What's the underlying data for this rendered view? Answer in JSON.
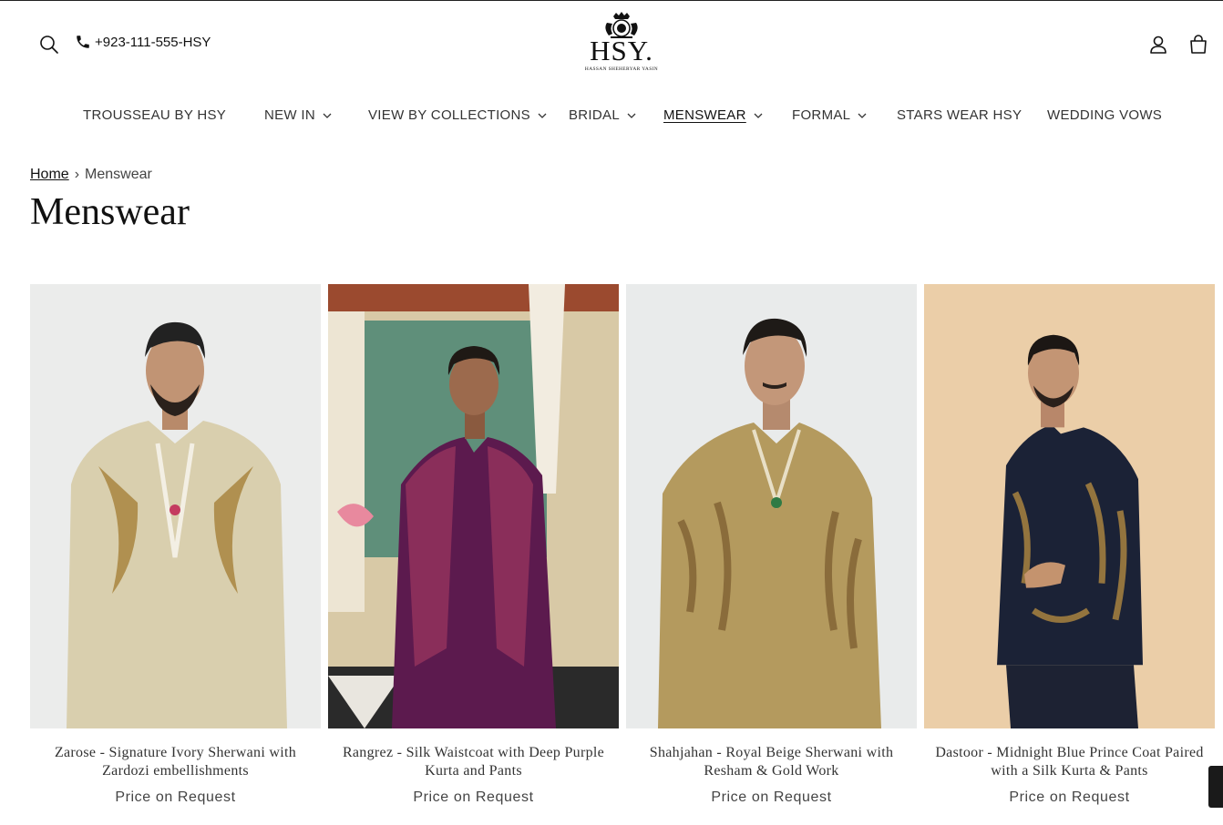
{
  "header": {
    "phone": "+923-111-555-HSY",
    "logo": {
      "mark": "HSY.",
      "tagline": "HASSAN SHEHERYAR YASIN"
    }
  },
  "nav": {
    "items": [
      {
        "label": "TROUSSEAU BY HSY",
        "has_dropdown": false,
        "active": false
      },
      {
        "label": "NEW IN",
        "has_dropdown": true,
        "active": false
      },
      {
        "label": "VIEW BY COLLECTIONS",
        "has_dropdown": true,
        "active": false
      },
      {
        "label": "BRIDAL",
        "has_dropdown": true,
        "active": false
      },
      {
        "label": "MENSWEAR",
        "has_dropdown": true,
        "active": true
      },
      {
        "label": "FORMAL",
        "has_dropdown": true,
        "active": false
      },
      {
        "label": "STARS WEAR HSY",
        "has_dropdown": false,
        "active": false
      },
      {
        "label": "WEDDING VOWS",
        "has_dropdown": false,
        "active": false
      }
    ]
  },
  "breadcrumb": {
    "home": "Home",
    "separator": "›",
    "current": "Menswear"
  },
  "page": {
    "title": "Menswear"
  },
  "products": [
    {
      "name": "Zarose - Signature Ivory Sherwani with Zardozi embellishments",
      "price": "Price on Request"
    },
    {
      "name": "Rangrez - Silk Waistcoat with Deep Purple Kurta and Pants",
      "price": "Price on Request"
    },
    {
      "name": "Shahjahan - Royal Beige Sherwani with Resham & Gold Work",
      "price": "Price on Request"
    },
    {
      "name": "Dastoor - Midnight Blue Prince Coat Paired with a Silk Kurta & Pants",
      "price": "Price on Request"
    }
  ],
  "colors": {
    "text": "#121212",
    "muted": "#444444",
    "background": "#ffffff"
  },
  "icons": [
    "search-icon",
    "phone-icon",
    "account-icon",
    "cart-icon",
    "chevron-down-icon"
  ]
}
